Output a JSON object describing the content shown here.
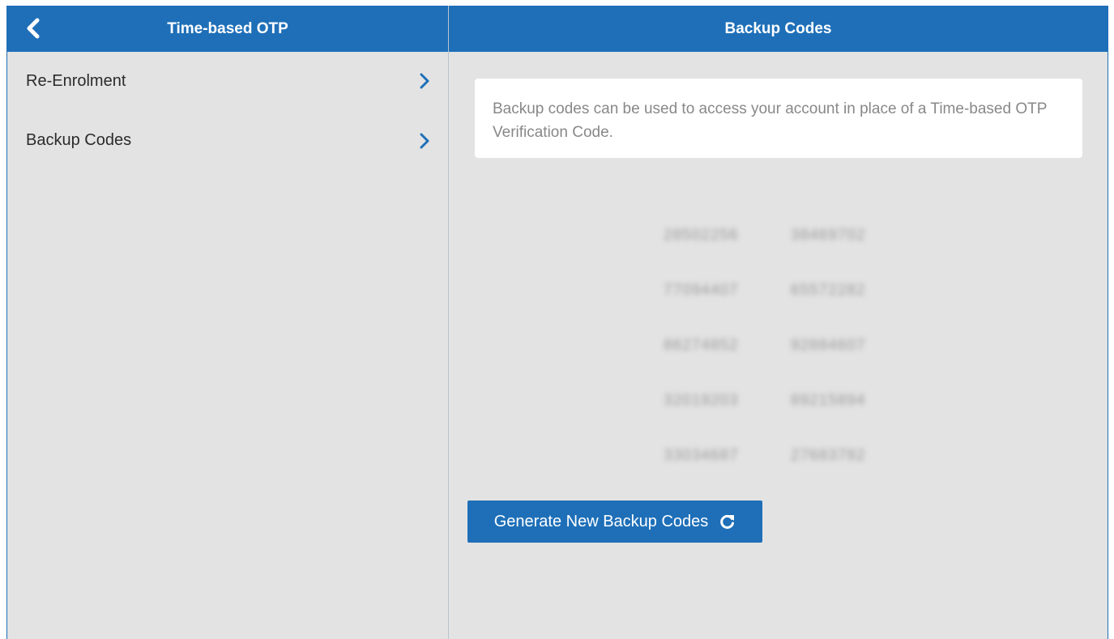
{
  "left_pane": {
    "title": "Time-based OTP",
    "back_icon": "chevron-left-icon",
    "menu": [
      {
        "label": "Re-Enrolment",
        "icon": "chevron-right-icon"
      },
      {
        "label": "Backup Codes",
        "icon": "chevron-right-icon"
      }
    ]
  },
  "right_pane": {
    "title": "Backup Codes",
    "info_text": "Backup codes can be used to access your account in place of a Time-based OTP Verification Code.",
    "codes": [
      "28502256",
      "38469702",
      "77094407",
      "65572282",
      "86274852",
      "92884607",
      "32019203",
      "89215894",
      "33034687",
      "27683782"
    ],
    "generate_button": {
      "label": "Generate New Backup Codes",
      "icon": "refresh-icon"
    }
  },
  "colors": {
    "accent": "#1e6fb8",
    "background": "#e3e3e3",
    "card": "#ffffff"
  }
}
